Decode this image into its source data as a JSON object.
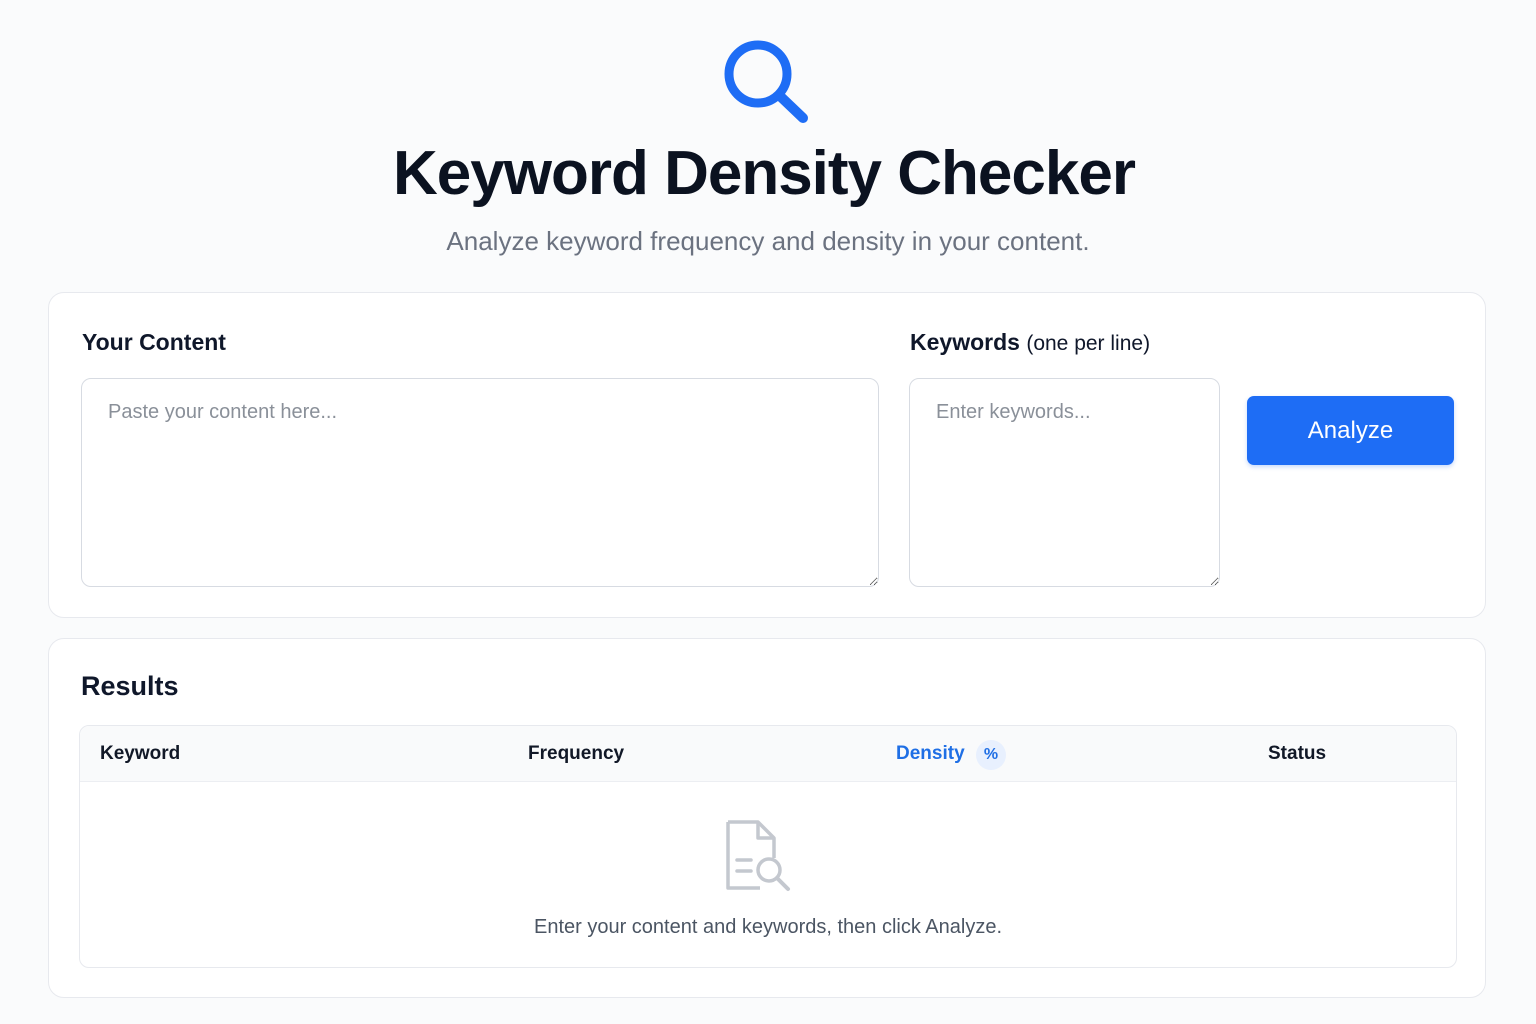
{
  "header": {
    "logo_icon": "magnifier-icon",
    "title": "Keyword Density Checker",
    "subtitle": "Analyze keyword frequency and density in your content."
  },
  "input": {
    "content_label": "Your Content",
    "content_placeholder": "Paste your content here...",
    "content_value": "",
    "keywords_label": "Keywords",
    "keywords_hint": "(one per line)",
    "keywords_placeholder": "Enter keywords...",
    "keywords_value": "",
    "analyze_label": "Analyze"
  },
  "results": {
    "title": "Results",
    "columns": {
      "keyword": "Keyword",
      "frequency": "Frequency",
      "density": "Density",
      "density_badge": "%",
      "status": "Status"
    },
    "rows": [],
    "empty_icon": "document-search-icon",
    "empty_message": "Enter your content and keywords, then click Analyze."
  },
  "colors": {
    "accent": "#1e6df5",
    "background": "#fafbfc",
    "card": "#ffffff",
    "muted_text": "#6b7280"
  }
}
